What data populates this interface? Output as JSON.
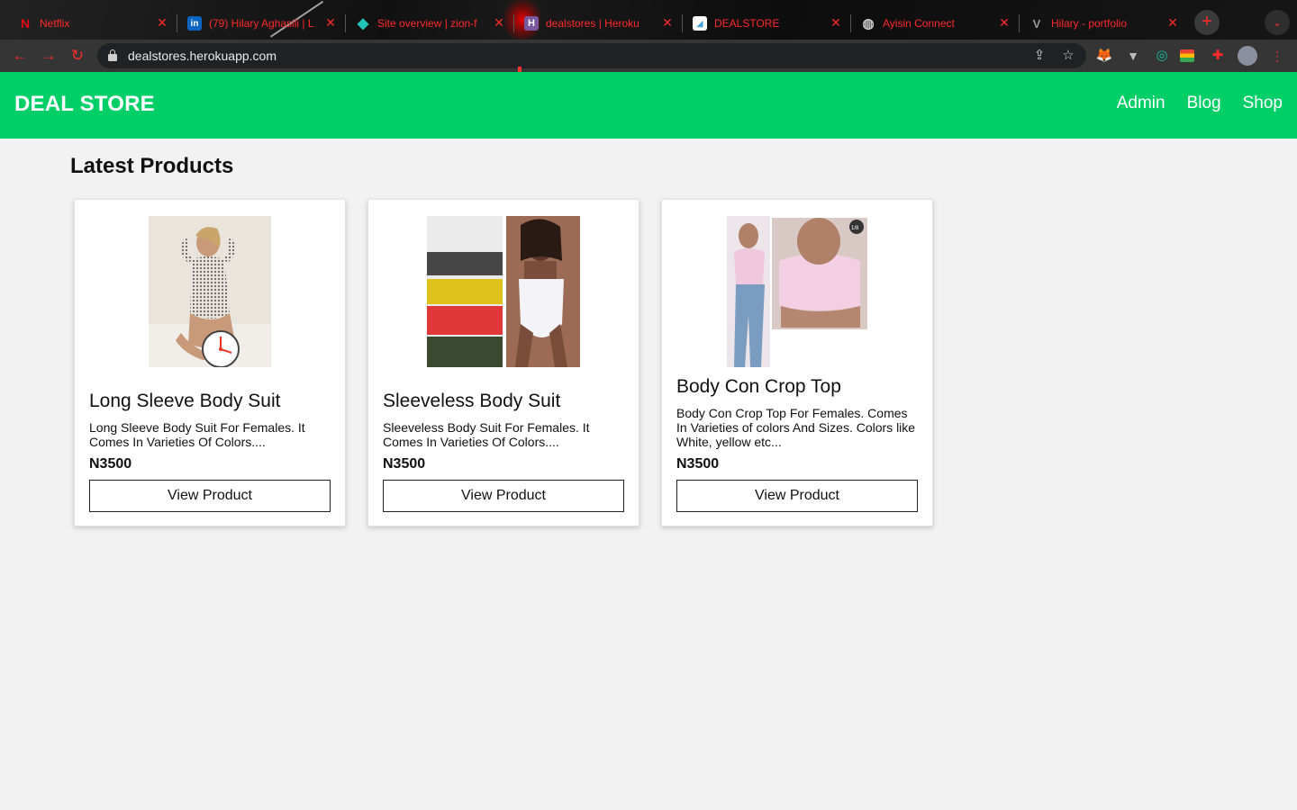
{
  "browser": {
    "tabs": [
      {
        "title": "Netflix",
        "favicon": "netflix-icon",
        "favicon_color": "#e50914",
        "favicon_glyph": "N"
      },
      {
        "title": "(79) Hilary Aghasili | L",
        "favicon": "linkedin-icon",
        "favicon_color": "#0a66c2",
        "favicon_glyph": "in"
      },
      {
        "title": "Site overview | zion-f",
        "favicon": "netlify-icon",
        "favicon_color": "#20c6b7",
        "favicon_glyph": "◆"
      },
      {
        "title": "dealstores | Heroku",
        "favicon": "heroku-icon",
        "favicon_color": "#79589f",
        "favicon_glyph": "H"
      },
      {
        "title": "DEALSTORE",
        "favicon": "page-icon",
        "favicon_color": "#ffffff",
        "favicon_glyph": "◢"
      },
      {
        "title": "Ayisin Connect",
        "favicon": "globe-icon",
        "favicon_color": "#888888",
        "favicon_glyph": "◍"
      },
      {
        "title": "Hilary - portfolio",
        "favicon": "vercel-v-icon",
        "favicon_color": "#444444",
        "favicon_glyph": "V"
      }
    ],
    "url": "dealstores.herokuapp.com",
    "accent_color": "#ff2a2a"
  },
  "site": {
    "brand": "DEAL STORE",
    "header_color": "#00cf68",
    "nav": [
      "Admin",
      "Blog",
      "Shop"
    ],
    "section_title": "Latest Products",
    "products": [
      {
        "name": "Long Sleeve Body Suit",
        "description": "Long Sleeve Body Suit For Females. It Comes In Varieties Of Colors....",
        "price": "N3500",
        "button": "View Product",
        "image": "long-sleeve-bodysuit-photo"
      },
      {
        "name": "Sleeveless Body Suit",
        "description": "Sleeveless Body Suit For Females. It Comes In Varieties Of Colors....",
        "price": "N3500",
        "button": "View Product",
        "image": "sleeveless-bodysuit-photo"
      },
      {
        "name": "Body Con Crop Top",
        "description": "Body Con Crop Top For Females. Comes In Varieties of colors And Sizes. Colors like White, yellow etc...",
        "price": "N3500",
        "button": "View Product",
        "image": "crop-top-photo"
      }
    ]
  }
}
